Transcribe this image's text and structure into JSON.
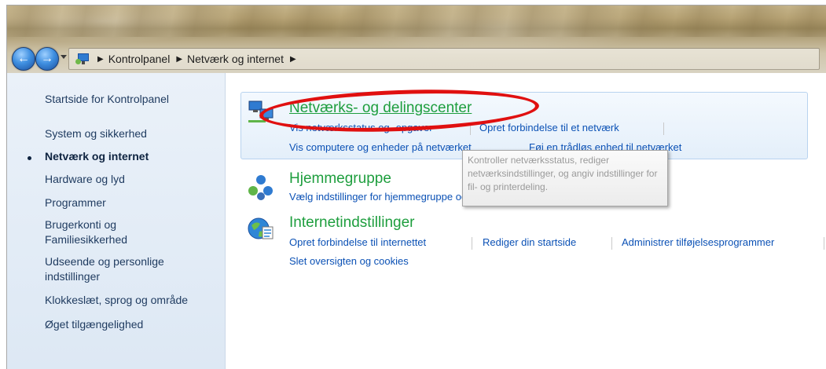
{
  "breadcrumb": {
    "items": [
      "Kontrolpanel",
      "Netværk og internet"
    ]
  },
  "sidebar": {
    "items": [
      {
        "label": "Startside for Kontrolpanel",
        "current": false
      },
      {
        "label": "System og sikkerhed",
        "current": false
      },
      {
        "label": "Netværk og internet",
        "current": true
      },
      {
        "label": "Hardware og lyd",
        "current": false
      },
      {
        "label": "Programmer",
        "current": false
      },
      {
        "label": "Brugerkonti og\nFamiliesikkerhed",
        "current": false
      },
      {
        "label": "Udseende og personlige\nindstillinger",
        "current": false
      },
      {
        "label": "Klokkeslæt, sprog og område",
        "current": false
      },
      {
        "label": "Øget tilgængelighed",
        "current": false
      }
    ]
  },
  "categories": [
    {
      "title": "Netværks- og delingscenter",
      "links": [
        "Vis netværksstatus og -opgaver",
        "Opret forbindelse til et netværk",
        "Vis computere og enheder på netværket",
        "Føj en trådløs enhed til netværket"
      ]
    },
    {
      "title": "Hjemmegruppe",
      "links": [
        "Vælg indstillinger for hjemmegruppe og deling"
      ]
    },
    {
      "title": "Internetindstillinger",
      "links": [
        "Opret forbindelse til internettet",
        "Rediger din startside",
        "Administrer tilføjelsesprogrammer",
        "Slet oversigten og cookies"
      ]
    }
  ],
  "tooltip": {
    "text": "Kontroller netværksstatus, rediger netværksindstillinger, og angiv indstillinger for fil- og printerdeling."
  },
  "colors": {
    "category_title": "#1e9e3e",
    "link": "#0b51b5",
    "highlight_ellipse": "#e01010"
  }
}
